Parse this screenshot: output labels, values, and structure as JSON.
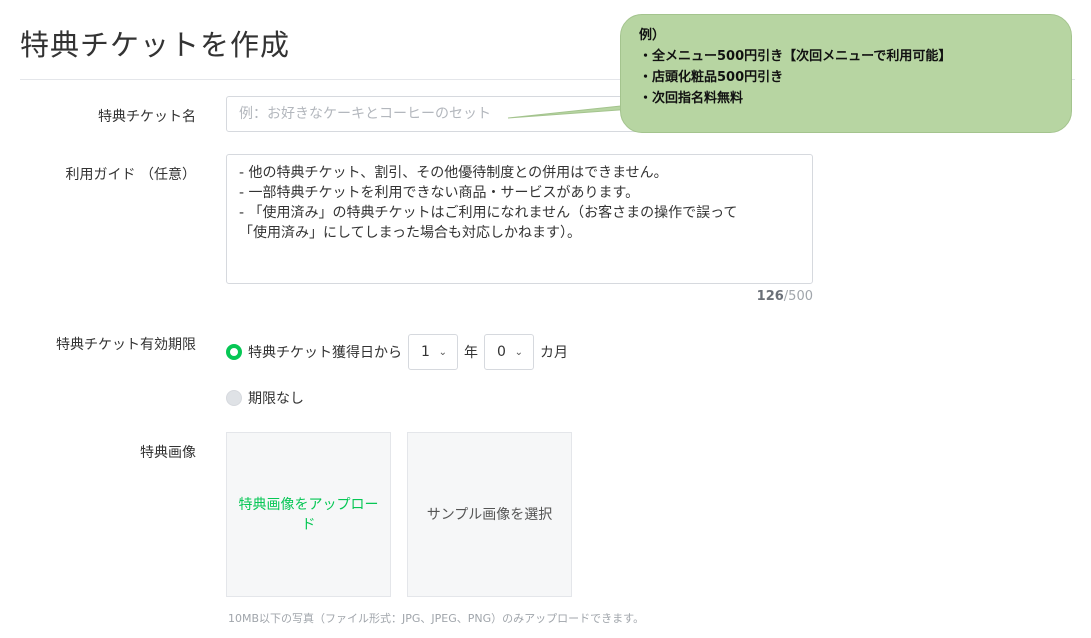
{
  "page": {
    "title": "特典チケットを作成"
  },
  "form": {
    "name": {
      "label": "特典チケット名",
      "placeholder": "例：お好きなケーキとコーヒーのセット"
    },
    "guide": {
      "label": "利用ガイド （任意）",
      "lines": [
        "- 他の特典チケット、割引、その他優待制度との併用はできません。",
        "- 一部特典チケットを利用できない商品・サービスがあります。",
        "- 「使用済み」の特典チケットはご利用になれません（お客さまの操作で誤って",
        "「使用済み」にしてしまった場合も対応しかねます）。"
      ],
      "count": "126",
      "max": "/500"
    },
    "validity": {
      "label": "特典チケット有効期限",
      "option1_text": "特典チケット獲得日から",
      "years_value": "1",
      "years_unit": "年",
      "months_value": "0",
      "months_unit": "カ月",
      "option2_text": "期限なし",
      "selected": "option1"
    },
    "image": {
      "label": "特典画像",
      "upload_label": "特典画像をアップロード",
      "sample_label": "サンプル画像を選択",
      "hint": "10MB以下の写真（ファイル形式：JPG、JPEG、PNG）のみアップロードできます。"
    }
  },
  "callout": {
    "lines": [
      "例）",
      "・全メニュー500円引き【次回メニューで利用可能】",
      "・店頭化粧品500円引き",
      "・次回指名料無料"
    ]
  },
  "colors": {
    "accent": "#06c755",
    "callout_bg": "#b7d5a2"
  },
  "icons": {
    "select_chevron": "chevron-down-icon"
  }
}
